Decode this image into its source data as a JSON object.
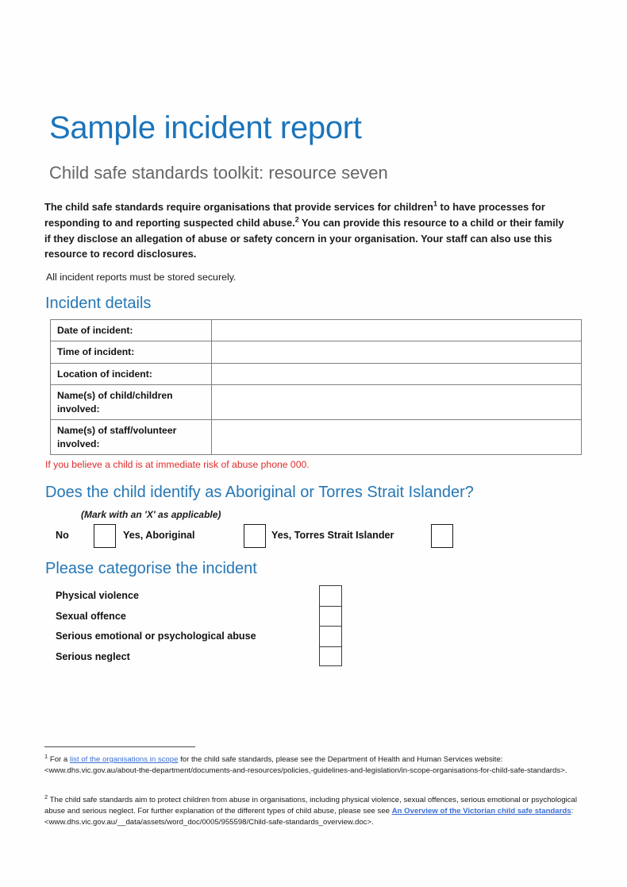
{
  "document": {
    "title": "Sample incident report",
    "subtitle": "Child safe standards toolkit: resource seven"
  },
  "intro": {
    "part1": "The child safe standards require organisations that provide services for children",
    "sup1": "1",
    "part2": " to have processes for responding to and reporting suspected child abuse.",
    "sup2": "2",
    "part3": " You can provide this resource to a child or their family if they disclose an allegation of abuse or safety concern in your organisation. Your staff can also use this resource to record disclosures.",
    "secure_note": "All incident reports must be stored securely."
  },
  "incident_details": {
    "heading": "Incident details",
    "rows": [
      {
        "label": "Date of incident:",
        "value": ""
      },
      {
        "label": "Time of incident:",
        "value": ""
      },
      {
        "label": "Location of incident:",
        "value": ""
      },
      {
        "label": "Name(s) of child/children involved:",
        "value": ""
      },
      {
        "label": "Name(s) of staff/volunteer involved:",
        "value": ""
      }
    ]
  },
  "alert": {
    "text": "If you believe a child is at immediate risk of abuse phone 000.",
    "color": "#e02b2b"
  },
  "aboriginal_question": {
    "heading": "Does the child identify as Aboriginal or Torres Strait Islander?",
    "mark_note": "(Mark with an 'X' as applicable)",
    "options": [
      {
        "label": "No",
        "checked": false
      },
      {
        "label": "Yes, Aboriginal",
        "checked": false
      },
      {
        "label": "Yes, Torres Strait Islander",
        "checked": false
      }
    ]
  },
  "categorise": {
    "heading": "Please categorise the incident",
    "items": [
      {
        "label": "Physical violence",
        "checked": false
      },
      {
        "label": "Sexual offence",
        "checked": false
      },
      {
        "label": "Serious emotional or psychological abuse",
        "checked": false
      },
      {
        "label": "Serious neglect",
        "checked": false
      }
    ]
  },
  "footnotes": {
    "one": {
      "marker": "1",
      "pre_link": " For a ",
      "link_text": "list of the organisations in scope",
      "post_link": " for the child safe standards, please see the Department of Health and Human Services website: <www.dhs.vic.gov.au/about-the-department/documents-and-resources/policies,-guidelines-and-legislation/in-scope-organisations-for-child-safe-standards>."
    },
    "two": {
      "marker": "2",
      "pre_link": " The child safe standards aim to protect children from abuse in organisations, including physical violence, sexual offences, serious emotional or psychological abuse and serious neglect. For further explanation of the different types of child abuse, please see see ",
      "link_text": "An Overview of the Victorian child safe standards",
      "post_link": ": <www.dhs.vic.gov.au/__data/assets/word_doc/0005/955598/Child-safe-standards_overview.doc>."
    }
  },
  "colors": {
    "heading_blue": "#2577b5",
    "title_blue": "#1b74bb",
    "subtitle_gray": "#666666",
    "alert_red": "#e02b2b",
    "link_blue": "#3b6fd4"
  }
}
